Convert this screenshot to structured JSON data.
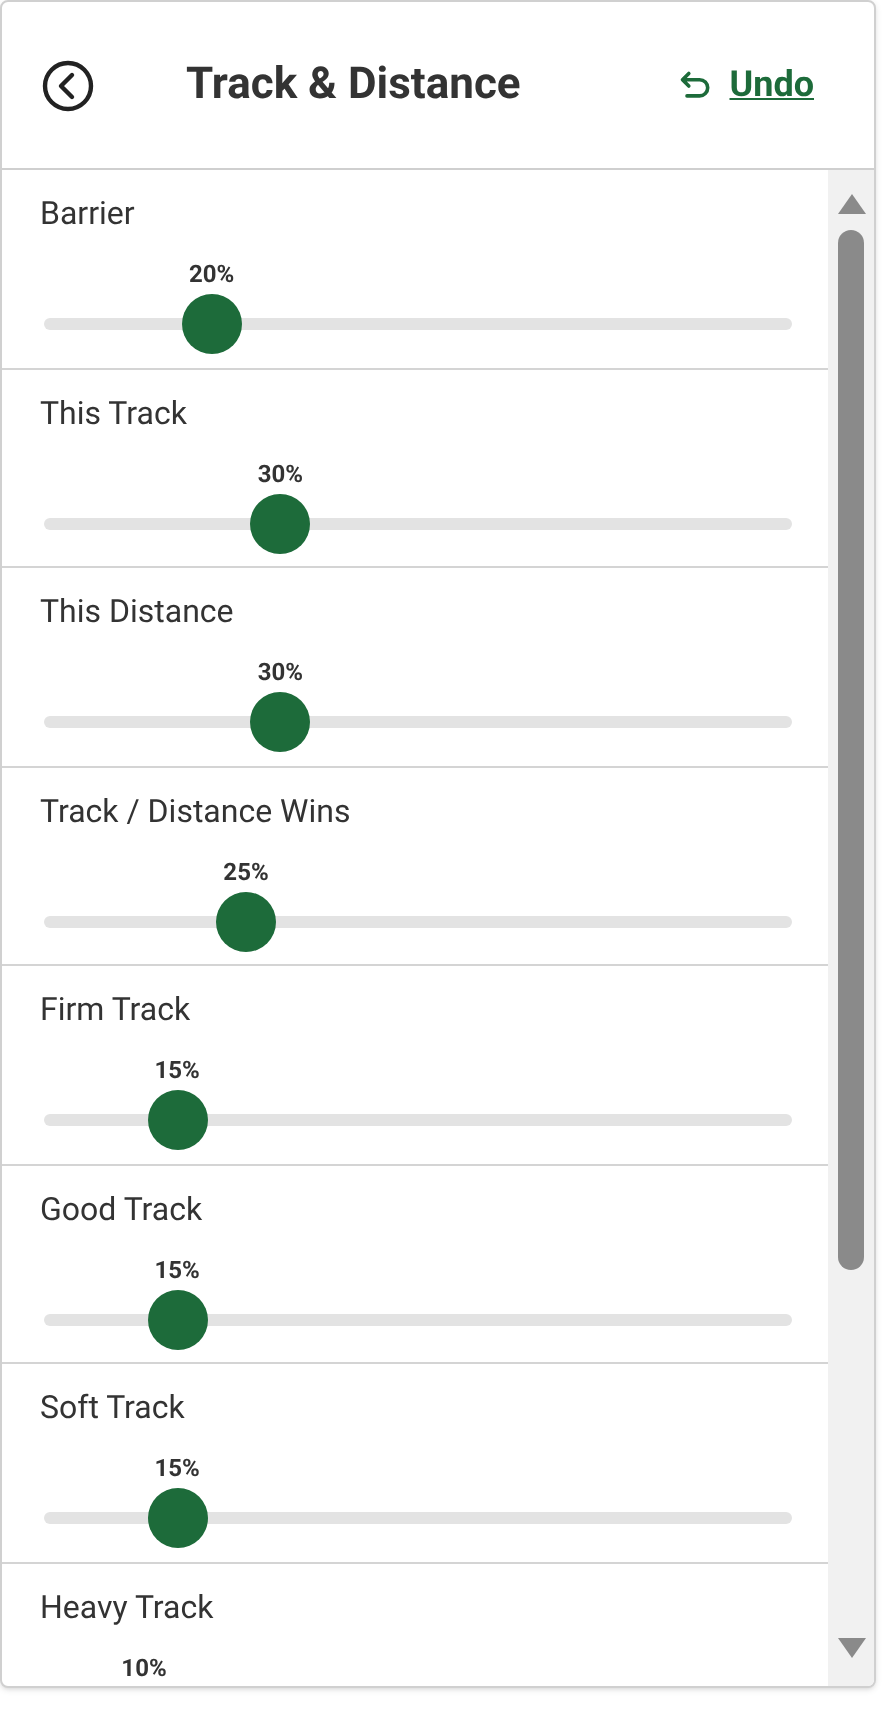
{
  "header": {
    "title": "Track & Distance",
    "undo": "Undo"
  },
  "sliders": [
    {
      "label": "Barrier",
      "reading": "20%",
      "level": 0.2
    },
    {
      "label": "This Track",
      "reading": "30%",
      "level": 0.3
    },
    {
      "label": "This Distance",
      "reading": "30%",
      "level": 0.3
    },
    {
      "label": "Track / Distance Wins",
      "reading": "25%",
      "level": 0.25
    },
    {
      "label": "Firm Track",
      "reading": "15%",
      "level": 0.15
    },
    {
      "label": "Good Track",
      "reading": "15%",
      "level": 0.15
    },
    {
      "label": "Soft Track",
      "reading": "15%",
      "level": 0.15
    },
    {
      "label": "Heavy Track",
      "reading": "10%"
    }
  ]
}
